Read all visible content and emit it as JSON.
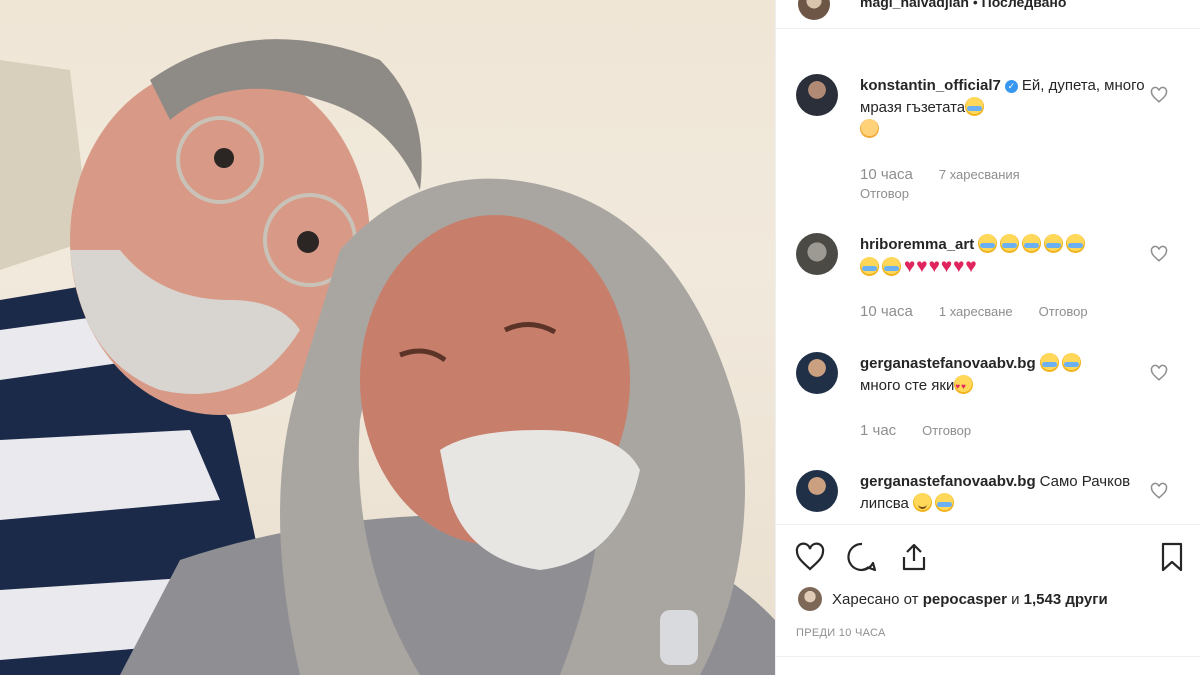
{
  "post": {
    "username": "magi_halvadjian",
    "separator": " • ",
    "follow_label": "Последвано"
  },
  "comments": [
    {
      "username": "konstantin_official7",
      "verified": true,
      "text": "Ей, дупета, много мразя гъзетата",
      "time": "10 часа",
      "likes": "7 харесвания",
      "reply": "Отговор"
    },
    {
      "username": "hriboremma_art",
      "verified": false,
      "text": "",
      "time": "10 часа",
      "likes": "1 харесване",
      "reply": "Отговор"
    },
    {
      "username": "gerganastefanovaabv.bg",
      "verified": false,
      "text": "много сте яки",
      "time": "1 час",
      "reply": "Отговор"
    },
    {
      "username": "gerganastefanovaabv.bg",
      "verified": false,
      "text": "Само Рачков липсва",
      "time": "",
      "reply": ""
    }
  ],
  "likes_bar": {
    "prefix": "Харесано от ",
    "liker": "pepocasper",
    "joiner": " и ",
    "others": "1,543 други"
  },
  "timestamp": "ПРЕДИ 10 ЧАСА",
  "icons": {
    "like": "heart-outline-icon",
    "comment": "speech-bubble-icon",
    "share": "share-icon",
    "save": "bookmark-icon"
  },
  "colors": {
    "verified": "#3897f0",
    "heart": "#e0245e",
    "muted": "#8e8e8e"
  }
}
